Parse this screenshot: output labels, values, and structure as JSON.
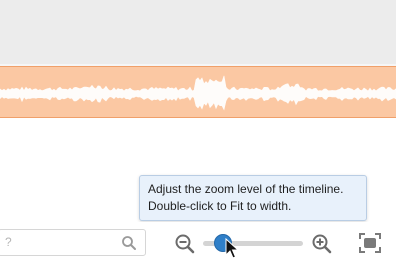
{
  "tooltip": {
    "line1": "Adjust the zoom level of the timeline.",
    "line2": "Double-click to Fit to width."
  },
  "search": {
    "placeholder": "?",
    "icon": "search-icon"
  },
  "zoom": {
    "zoom_out_icon": "zoom-out-icon",
    "zoom_in_icon": "zoom-in-icon",
    "fit_icon": "fit-to-width-icon",
    "level": 0.2
  },
  "colors": {
    "clip_fill": "#fbc8a3",
    "clip_border": "#f0a06a",
    "waveform": "#ffffff",
    "slider_thumb": "#2f7fc8",
    "tooltip_bg": "#e8f1fb"
  }
}
